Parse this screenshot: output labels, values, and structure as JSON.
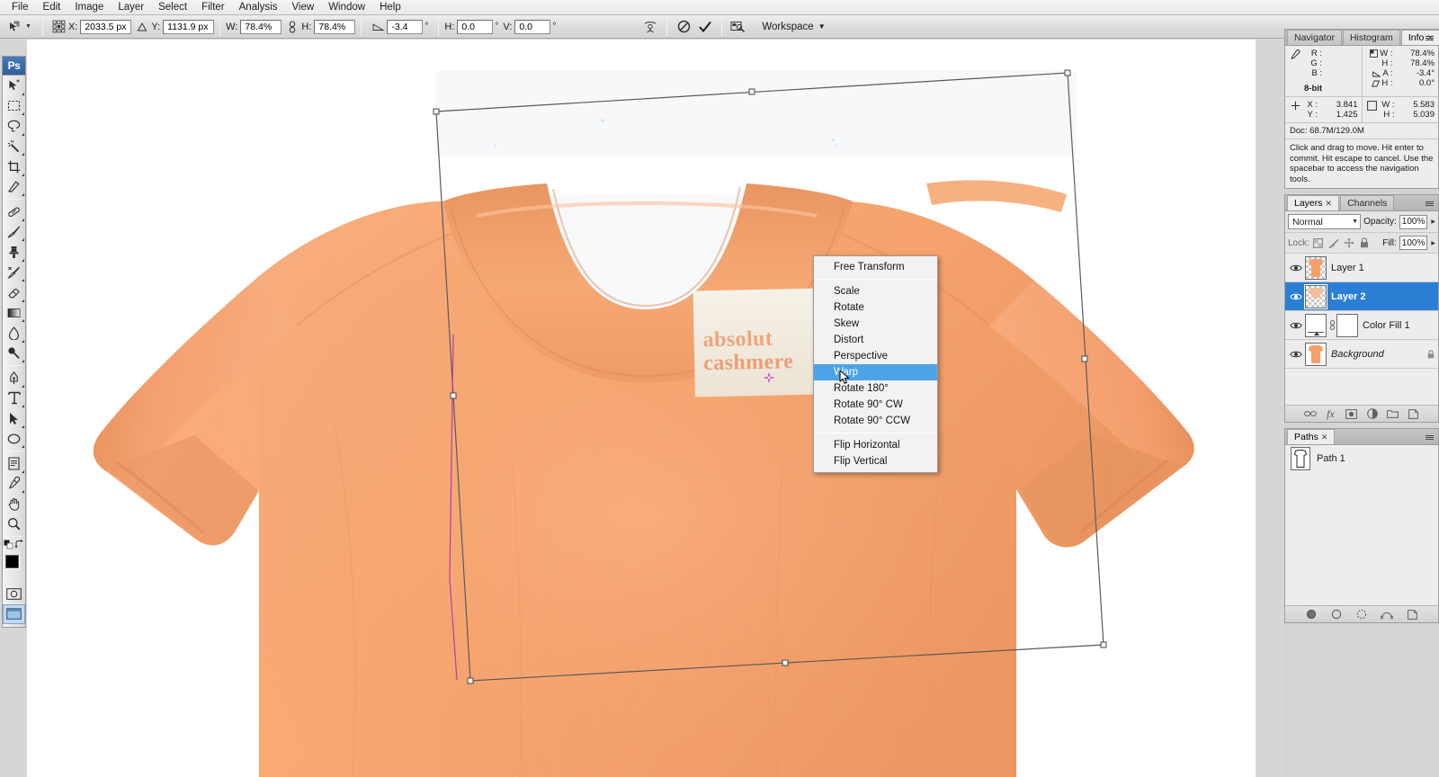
{
  "menubar": {
    "items": [
      {
        "label": "File"
      },
      {
        "label": "Edit"
      },
      {
        "label": "Image"
      },
      {
        "label": "Layer"
      },
      {
        "label": "Select"
      },
      {
        "label": "Filter"
      },
      {
        "label": "Analysis"
      },
      {
        "label": "View"
      },
      {
        "label": "Window"
      },
      {
        "label": "Help"
      }
    ]
  },
  "options_bar": {
    "tool_icon": "move-tool-icon",
    "reference_point_icon": "reference-point-grid-icon",
    "x_label": "X:",
    "x_value": "2033.5 px",
    "link_xy_icon": "delta-triangle-icon",
    "y_label": "Y:",
    "y_value": "1131.9 px",
    "w_label": "W:",
    "w_value": "78.4%",
    "chain_icon": "chain-link-icon",
    "h_label": "H:",
    "h_value": "78.4%",
    "angle_icon": "angle-triangle-icon",
    "angle_value": "-3.4",
    "angle_unit": "°",
    "skew_h_label": "H:",
    "skew_h_value": "0.0",
    "skew_h_unit": "°",
    "skew_v_label": "V:",
    "skew_v_value": "0.0",
    "skew_v_unit": "°",
    "warp_toggle_icon": "switch-warp-mode-icon",
    "cancel_icon": "cancel-transform-icon",
    "commit_icon": "commit-transform-checkmark-icon",
    "bridge_icon": "go-to-bridge-icon",
    "workspace_label": "Workspace",
    "workspace_caret_icon": "chevron-down-icon"
  },
  "toolbox": {
    "logo": "Ps",
    "tools": [
      {
        "name": "move-tool",
        "icon": "move-tool-icon",
        "has_flyout": true,
        "selected": false
      },
      {
        "name": "marquee-tool",
        "icon": "rectangular-marquee-icon",
        "has_flyout": true,
        "selected": false
      },
      {
        "name": "lasso-tool",
        "icon": "lasso-icon",
        "has_flyout": true,
        "selected": false
      },
      {
        "name": "magic-wand-tool",
        "icon": "magic-wand-icon",
        "has_flyout": true,
        "selected": false
      },
      {
        "name": "crop-tool",
        "icon": "crop-icon",
        "has_flyout": true,
        "selected": false
      },
      {
        "name": "slice-tool",
        "icon": "slice-knife-icon",
        "has_flyout": true,
        "selected": false
      },
      {
        "name": "healing-brush-tool",
        "icon": "healing-bandage-icon",
        "has_flyout": true,
        "selected": false
      },
      {
        "name": "brush-tool",
        "icon": "paintbrush-icon",
        "has_flyout": true,
        "selected": false
      },
      {
        "name": "clone-stamp-tool",
        "icon": "clone-stamp-icon",
        "has_flyout": true,
        "selected": false
      },
      {
        "name": "history-brush-tool",
        "icon": "history-brush-icon",
        "has_flyout": true,
        "selected": false
      },
      {
        "name": "eraser-tool",
        "icon": "eraser-icon",
        "has_flyout": true,
        "selected": false
      },
      {
        "name": "gradient-tool",
        "icon": "gradient-icon",
        "has_flyout": true,
        "selected": false
      },
      {
        "name": "blur-tool",
        "icon": "blur-waterdrop-icon",
        "has_flyout": true,
        "selected": false
      },
      {
        "name": "dodge-tool",
        "icon": "dodge-burn-icon",
        "has_flyout": true,
        "selected": false
      },
      {
        "name": "pen-tool",
        "icon": "pen-nib-icon",
        "has_flyout": true,
        "selected": false
      },
      {
        "name": "type-tool",
        "icon": "type-t-icon",
        "has_flyout": true,
        "selected": false
      },
      {
        "name": "path-selection-tool",
        "icon": "path-arrow-icon",
        "has_flyout": true,
        "selected": false
      },
      {
        "name": "shape-tool",
        "icon": "ellipse-shape-icon",
        "has_flyout": true,
        "selected": false
      },
      {
        "name": "notes-tool",
        "icon": "notes-icon",
        "has_flyout": true,
        "selected": false
      },
      {
        "name": "eyedropper-tool",
        "icon": "eyedropper-icon",
        "has_flyout": true,
        "selected": false
      },
      {
        "name": "hand-tool",
        "icon": "hand-icon",
        "has_flyout": false,
        "selected": false
      },
      {
        "name": "zoom-tool",
        "icon": "magnifier-icon",
        "has_flyout": false,
        "selected": false
      }
    ],
    "foreground_color": "#000000",
    "background_color": "#ffffff",
    "swap_colors_icon": "swap-colors-icon",
    "default_colors_icon": "default-colors-icon",
    "quick_mask_icon": "quick-mask-mode-icon",
    "screen_mode_icon": "screen-mode-icon"
  },
  "canvas": {
    "background_color": "#ffffff",
    "garment_color": "#f5a06a",
    "label_line1": "absolut",
    "label_line2": "cashmere",
    "transform_box_color": "#5b5b5b",
    "path_color": "#b03fb0",
    "pivot_icon": "transform-pivot-point-icon"
  },
  "context_menu": {
    "highlighted": "Warp",
    "cursor_icon": "mouse-pointer-icon",
    "groups": [
      [
        "Free Transform"
      ],
      [
        "Scale",
        "Rotate",
        "Skew",
        "Distort",
        "Perspective",
        "Warp"
      ],
      [
        "Rotate 180°",
        "Rotate 90° CW",
        "Rotate 90° CCW"
      ],
      [
        "Flip Horizontal",
        "Flip Vertical"
      ]
    ]
  },
  "info_panel": {
    "tabs": [
      {
        "label": "Navigator",
        "active": false,
        "closable": false
      },
      {
        "label": "Histogram",
        "active": false,
        "closable": false
      },
      {
        "label": "Info",
        "active": true,
        "closable": true
      }
    ],
    "menu_icon": "panel-menu-icon",
    "color_readout": {
      "icon": "eyedropper-readout-icon",
      "keys": [
        "R :",
        "G :",
        "B :"
      ],
      "values": [
        "",
        "",
        ""
      ],
      "depth": "8-bit"
    },
    "transform_readout": {
      "rows": [
        {
          "icon": "scale-icon",
          "key": "W :",
          "value": "78.4%"
        },
        {
          "icon": "scale-icon",
          "key": "H :",
          "value": "78.4%"
        },
        {
          "icon": "angle-icon",
          "key": "A :",
          "value": "-3.4°"
        },
        {
          "icon": "skew-icon",
          "key": "H :",
          "value": "0.0°"
        }
      ]
    },
    "position_readout": {
      "icon": "crosshair-position-icon",
      "keys": [
        "X :",
        "Y :"
      ],
      "values": [
        "3.841",
        "1.425"
      ]
    },
    "size_readout": {
      "icon": "marquee-size-icon",
      "keys": [
        "W :",
        "H :"
      ],
      "values": [
        "5.583",
        "5.039"
      ]
    },
    "doc_label": "Doc: 68.7M/129.0M",
    "hint_text": "Click and drag to move. Hit enter to commit. Hit escape to cancel. Use the spacebar to access the navigation tools."
  },
  "layers_panel": {
    "tabs": [
      {
        "label": "Layers",
        "active": true,
        "closable": true
      },
      {
        "label": "Channels",
        "active": false,
        "closable": false
      }
    ],
    "menu_icon": "panel-menu-icon",
    "blend_mode": "Normal",
    "blend_caret_icon": "chevron-down-icon",
    "opacity_label": "Opacity:",
    "opacity_value": "100%",
    "lock_label": "Lock:",
    "lock_icons": [
      "lock-transparent-pixels-icon",
      "lock-image-pixels-icon",
      "lock-position-icon",
      "lock-all-icon"
    ],
    "fill_label": "Fill:",
    "fill_value": "100%",
    "layers": [
      {
        "name": "Layer 1",
        "visible": true,
        "selected": false,
        "italic": false,
        "kind": "raster",
        "thumb": "garment",
        "has_mask": false,
        "locked": false
      },
      {
        "name": "Layer 2",
        "visible": true,
        "selected": true,
        "italic": false,
        "kind": "raster",
        "thumb": "garment-transparent",
        "has_mask": false,
        "locked": false
      },
      {
        "name": "Color Fill 1",
        "visible": true,
        "selected": false,
        "italic": false,
        "kind": "fill",
        "thumb": "solid-white",
        "has_mask": true,
        "locked": false
      },
      {
        "name": "Background",
        "visible": true,
        "selected": false,
        "italic": true,
        "kind": "raster",
        "thumb": "garment",
        "has_mask": false,
        "locked": true
      }
    ],
    "eye_icon": "eye-visibility-icon",
    "link_mask_icon": "link-mask-icon",
    "bottom_buttons": [
      {
        "name": "link-layers-button",
        "icon": "chain-link-icon"
      },
      {
        "name": "layer-style-button",
        "icon": "fx-icon"
      },
      {
        "name": "add-layer-mask-button",
        "icon": "add-mask-icon"
      },
      {
        "name": "new-adjustment-layer-button",
        "icon": "half-circle-icon"
      },
      {
        "name": "new-group-button",
        "icon": "folder-icon"
      },
      {
        "name": "new-layer-button",
        "icon": "new-layer-icon"
      }
    ]
  },
  "paths_panel": {
    "tabs": [
      {
        "label": "Paths",
        "active": true,
        "closable": true
      }
    ],
    "menu_icon": "panel-menu-icon",
    "paths": [
      {
        "name": "Path 1",
        "thumb": "garment-silhouette"
      }
    ],
    "bottom_buttons": [
      {
        "name": "fill-path-button",
        "icon": "fill-path-icon"
      },
      {
        "name": "stroke-path-button",
        "icon": "stroke-path-icon"
      },
      {
        "name": "load-path-as-selection-button",
        "icon": "selection-circle-icon"
      },
      {
        "name": "make-work-path-button",
        "icon": "make-work-path-icon"
      },
      {
        "name": "new-path-button",
        "icon": "new-path-icon"
      }
    ]
  },
  "colors": {
    "accent_blue": "#2a7fd4",
    "menu_highlight": "#4da3e8",
    "panel_bg": "#ededed",
    "chrome_bg": "#d4d4d4"
  }
}
